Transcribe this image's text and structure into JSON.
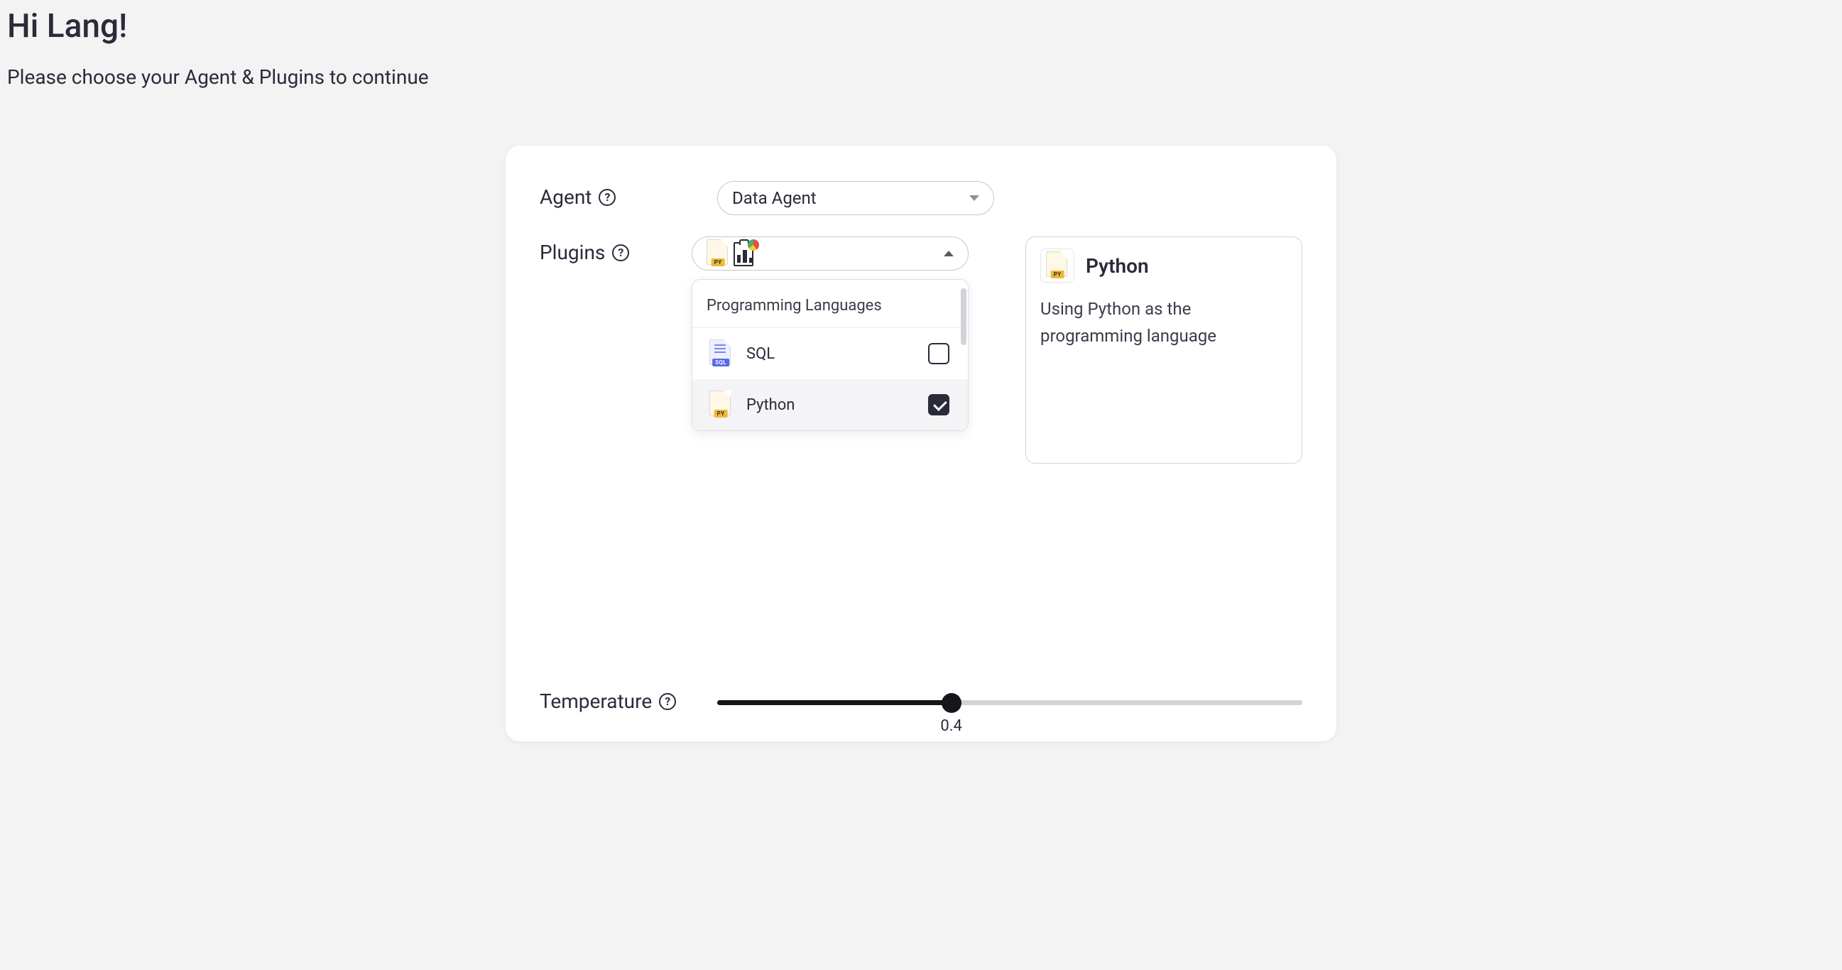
{
  "greeting": "Hi Lang!",
  "subtitle": "Please choose your Agent & Plugins to continue",
  "form": {
    "agent": {
      "label": "Agent",
      "selected": "Data Agent"
    },
    "plugins": {
      "label": "Plugins",
      "selected_icons": [
        "python-file",
        "report-analytics"
      ],
      "dropdown": {
        "group_header": "Programming Languages",
        "options": [
          {
            "label": "SQL",
            "icon": "sql-file",
            "checked": false
          },
          {
            "label": "Python",
            "icon": "python-file",
            "checked": true
          }
        ]
      },
      "detail": {
        "title": "Python",
        "description": "Using Python as the programming language"
      }
    },
    "temperature": {
      "label": "Temperature",
      "value": "0.4",
      "min": 0,
      "max": 1
    }
  }
}
